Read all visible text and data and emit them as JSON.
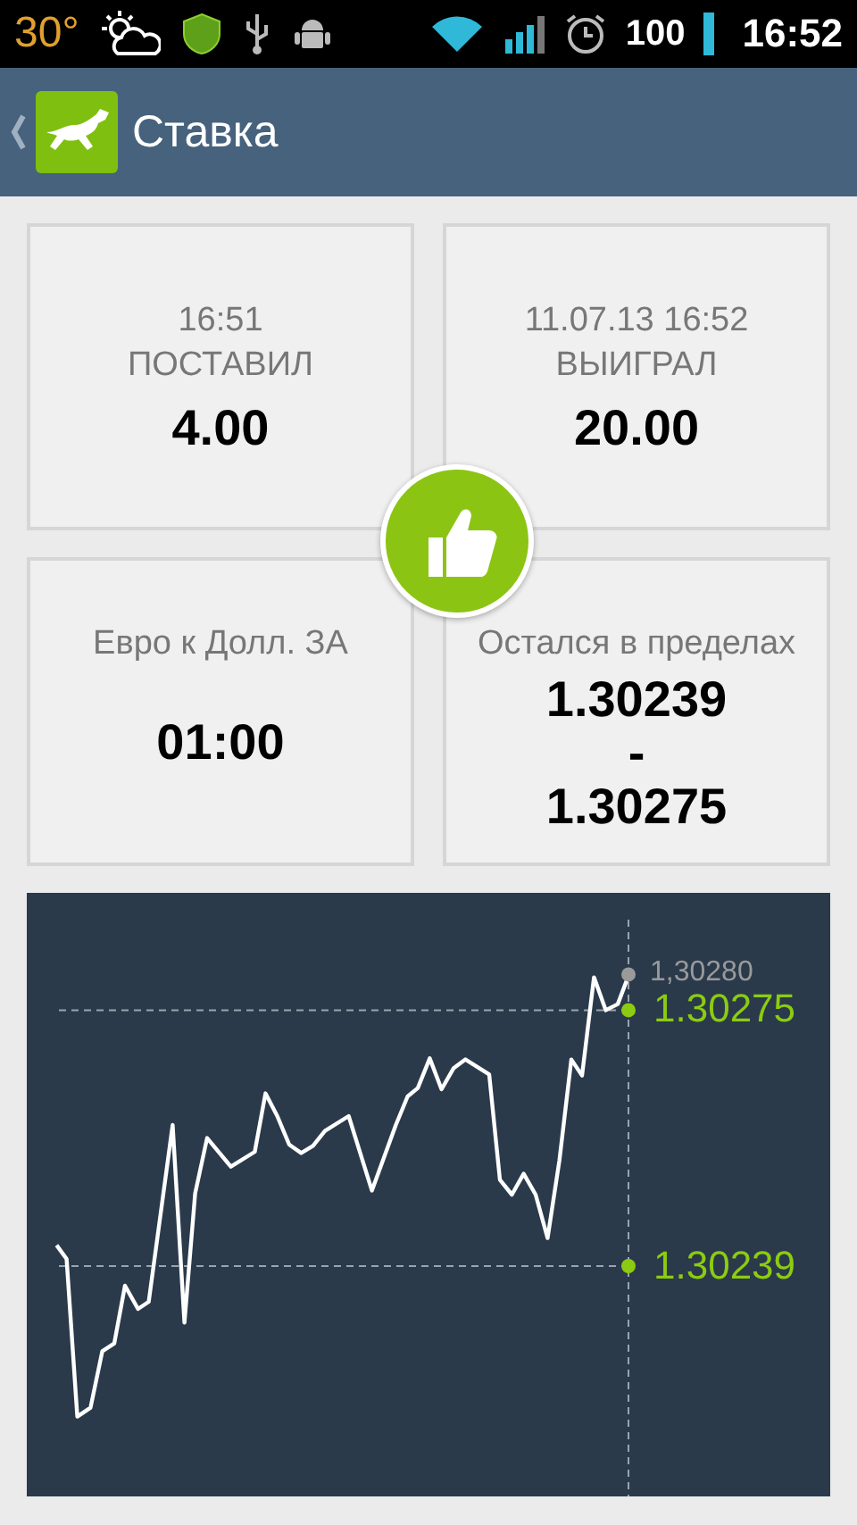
{
  "status_bar": {
    "temperature": "30°",
    "battery": "100",
    "time": "16:52"
  },
  "action_bar": {
    "title": "Ставка"
  },
  "cards": [
    {
      "caption": [
        "16:51",
        "ПОСТАВИЛ"
      ],
      "value": [
        "4.00"
      ]
    },
    {
      "caption": [
        "11.07.13 16:52",
        "ВЫИГРАЛ"
      ],
      "value": [
        "20.00"
      ]
    },
    {
      "caption": [
        "Евро к Долл. ЗА"
      ],
      "value": [
        "01:00"
      ]
    },
    {
      "caption": [
        "Остался в пределах"
      ],
      "value": [
        "1.30239",
        "-",
        "1.30275"
      ]
    }
  ],
  "chart": {
    "current": "1,30280",
    "upper": "1.30275",
    "lower": "1.30239"
  }
}
